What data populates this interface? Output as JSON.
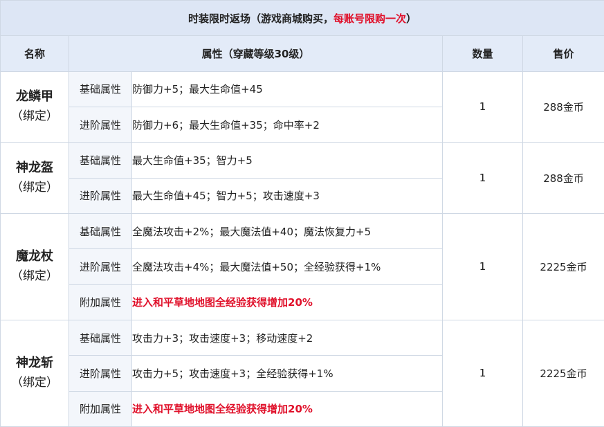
{
  "title": {
    "main": "时装限时返场（游戏商城购买，",
    "highlight": "每账号限购一次",
    "tail": "）"
  },
  "headers": {
    "name": "名称",
    "attributes": "属性（穿藏等级30级）",
    "quantity": "数量",
    "price": "售价"
  },
  "items": [
    {
      "name": "龙鳞甲",
      "bound": "（绑定）",
      "quantity": "1",
      "price": "288金币",
      "attrs": [
        {
          "type": "基础属性",
          "value": "防御力+5；最大生命值+45"
        },
        {
          "type": "进阶属性",
          "value": "防御力+6；最大生命值+35；命中率+2"
        }
      ]
    },
    {
      "name": "神龙盔",
      "bound": "（绑定）",
      "quantity": "1",
      "price": "288金币",
      "attrs": [
        {
          "type": "基础属性",
          "value": "最大生命值+35；智力+5"
        },
        {
          "type": "进阶属性",
          "value": "最大生命值+45；智力+5；攻击速度+3"
        }
      ]
    },
    {
      "name": "魔龙杖",
      "bound": "（绑定）",
      "quantity": "1",
      "price": "2225金币",
      "attrs": [
        {
          "type": "基础属性",
          "value": "全魔法攻击+2%；最大魔法值+40；魔法恢复力+5"
        },
        {
          "type": "进阶属性",
          "value": "全魔法攻击+4%；最大魔法值+50；全经验获得+1%"
        },
        {
          "type": "附加属性",
          "value": "进入和平草地地图全经验获得增加20%"
        }
      ]
    },
    {
      "name": "神龙斩",
      "bound": "（绑定）",
      "quantity": "1",
      "price": "2225金币",
      "attrs": [
        {
          "type": "基础属性",
          "value": "攻击力+3；攻击速度+3；移动速度+2"
        },
        {
          "type": "进阶属性",
          "value": "攻击力+5；攻击速度+3；全经验获得+1%"
        },
        {
          "type": "附加属性",
          "value": "进入和平草地地图全经验获得增加20%"
        }
      ]
    }
  ],
  "colors": {
    "title_bg": "#dde6f5",
    "header_bg": "#e3ebf8",
    "type_bg": "#f3f6fb",
    "highlight": "#e0102a",
    "border": "#cfd8e4"
  }
}
